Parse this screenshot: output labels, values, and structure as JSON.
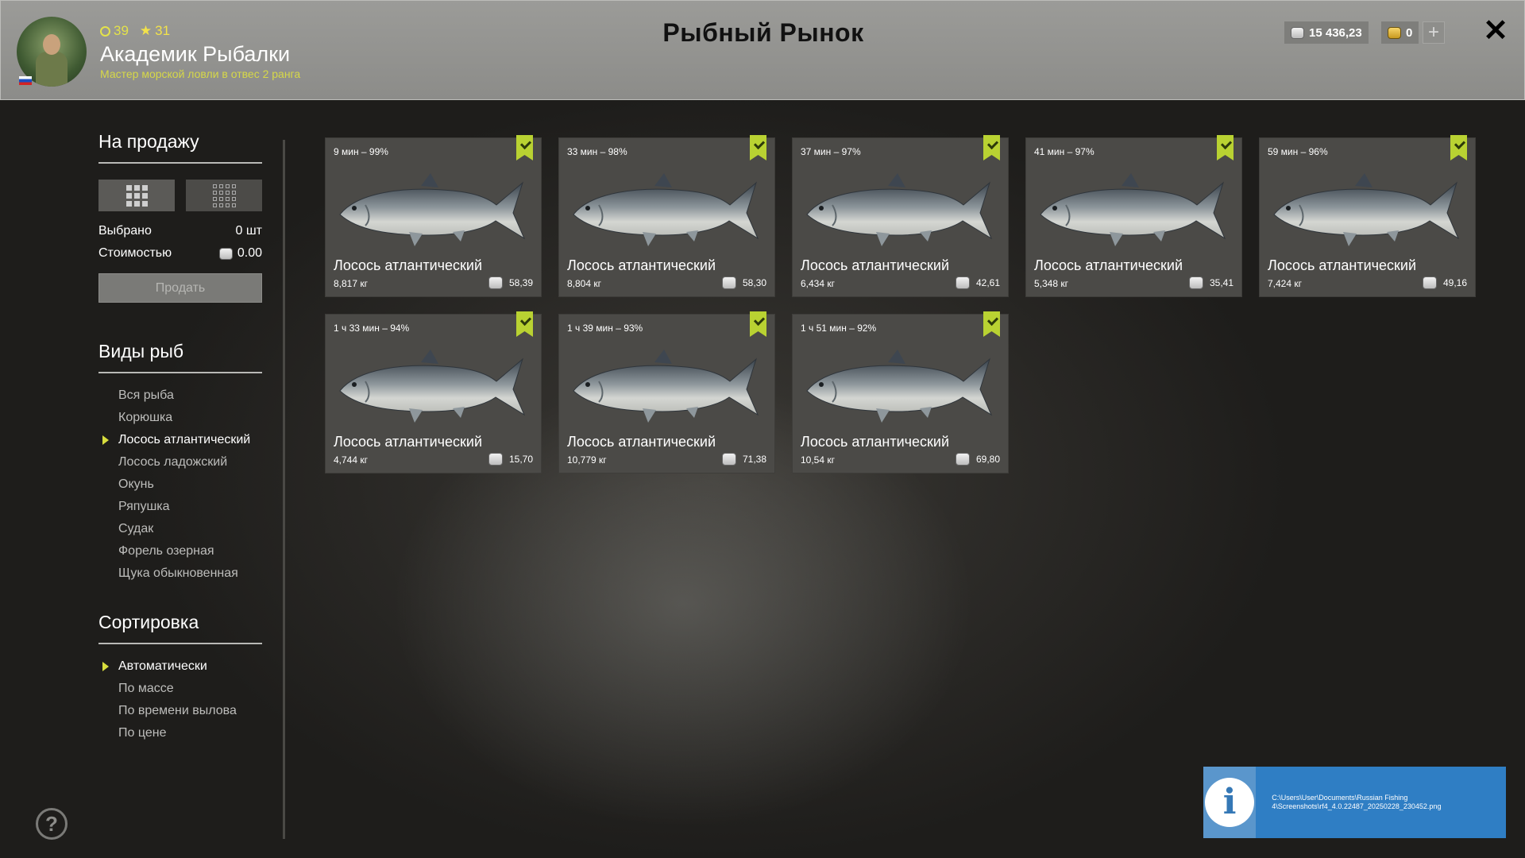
{
  "header": {
    "title": "Рыбный Рынок",
    "player": {
      "level": "39",
      "rank": "31",
      "name": "Академик Рыбалки",
      "subtitle": "Мастер морской ловли в отвес 2 ранга"
    },
    "silver": "15 436,23",
    "gold": "0",
    "plus_icon": "plus-icon",
    "close_icon": "close-icon"
  },
  "sidebar": {
    "for_sale_title": "На продажу",
    "selected_label": "Выбрано",
    "selected_value": "0 шт",
    "cost_label": "Стоимостью",
    "cost_value": "0.00",
    "sell_button": "Продать",
    "species_title": "Виды рыб",
    "species": [
      "Вся рыба",
      "Корюшка",
      "Лосось атлантический",
      "Лосось ладожский",
      "Окунь",
      "Ряпушка",
      "Судак",
      "Форель озерная",
      "Щука обыкновенная"
    ],
    "species_active": 2,
    "sort_title": "Сортировка",
    "sort_options": [
      "Автоматически",
      "По массе",
      "По времени вылова",
      "По цене"
    ],
    "sort_active": 0
  },
  "cards": [
    {
      "time": "9 мин – 99%",
      "name": "Лосось атлантический",
      "weight": "8,817 кг",
      "price": "58,39"
    },
    {
      "time": "33 мин – 98%",
      "name": "Лосось атлантический",
      "weight": "8,804 кг",
      "price": "58,30"
    },
    {
      "time": "37 мин – 97%",
      "name": "Лосось атлантический",
      "weight": "6,434 кг",
      "price": "42,61"
    },
    {
      "time": "41 мин – 97%",
      "name": "Лосось атлантический",
      "weight": "5,348 кг",
      "price": "35,41"
    },
    {
      "time": "59 мин – 96%",
      "name": "Лосось атлантический",
      "weight": "7,424 кг",
      "price": "49,16"
    },
    {
      "time": "1 ч 33 мин – 94%",
      "name": "Лосось атлантический",
      "weight": "4,744 кг",
      "price": "15,70"
    },
    {
      "time": "1 ч 39 мин – 93%",
      "name": "Лосось атлантический",
      "weight": "10,779 кг",
      "price": "71,38"
    },
    {
      "time": "1 ч 51 мин – 92%",
      "name": "Лосось атлантический",
      "weight": "10,54 кг",
      "price": "69,80"
    }
  ],
  "notification": {
    "icon": "info-icon",
    "text": "C:\\Users\\User\\Documents\\Russian Fishing 4\\Screenshots\\rf4_4.0.22487_20250228_230452.png"
  },
  "help_icon": "help-icon",
  "colors": {
    "accent": "#b9d232",
    "header_bg": "#9b9b98",
    "card_bg": "#4b4a47",
    "notification_bg": "#2f7ec4"
  }
}
